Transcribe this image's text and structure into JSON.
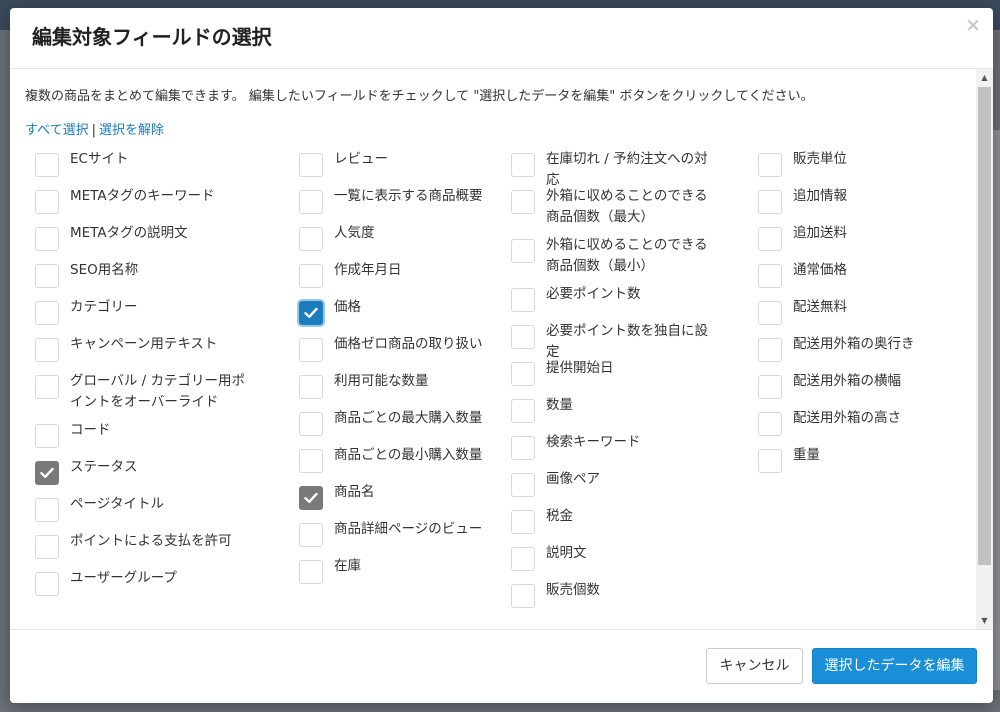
{
  "modal": {
    "title": "編集対象フィールドの選択",
    "close": "×",
    "description": "複数の商品をまとめて編集できます。 編集したいフィールドをチェックして \"選択したデータを編集\" ボタンをクリックしてください。",
    "select_all": "すべて選択",
    "separator": "|",
    "deselect": "選択を解除",
    "cancel_label": "キャンセル",
    "submit_label": "選択したデータを編集"
  },
  "fields": {
    "col1": [
      {
        "label": "ECサイト",
        "checked": false
      },
      {
        "label": "METAタグのキーワード",
        "checked": false
      },
      {
        "label": "METAタグの説明文",
        "checked": false
      },
      {
        "label": "SEO用名称",
        "checked": false
      },
      {
        "label": "カテゴリー",
        "checked": false
      },
      {
        "label": "キャンペーン用テキスト",
        "checked": false
      },
      {
        "label": "グローバル / カテゴリー用ポイントをオーバーライド",
        "checked": false
      },
      {
        "label": "コード",
        "checked": false
      },
      {
        "label": "ステータス",
        "checked": true
      },
      {
        "label": "ページタイトル",
        "checked": false
      },
      {
        "label": "ポイントによる支払を許可",
        "checked": false
      },
      {
        "label": "ユーザーグループ",
        "checked": false
      }
    ],
    "col2": [
      {
        "label": "レビュー",
        "checked": false
      },
      {
        "label": "一覧に表示する商品概要",
        "checked": false
      },
      {
        "label": "人気度",
        "checked": false
      },
      {
        "label": "作成年月日",
        "checked": false
      },
      {
        "label": "価格",
        "checked": true
      },
      {
        "label": "価格ゼロ商品の取り扱い",
        "checked": false
      },
      {
        "label": "利用可能な数量",
        "checked": false
      },
      {
        "label": "商品ごとの最大購入数量",
        "checked": false
      },
      {
        "label": "商品ごとの最小購入数量",
        "checked": false
      },
      {
        "label": "商品名",
        "checked": true
      },
      {
        "label": "商品詳細ページのビュー",
        "checked": false
      },
      {
        "label": "在庫",
        "checked": false
      }
    ],
    "col3": [
      {
        "label": "在庫切れ / 予約注文への対応",
        "checked": false
      },
      {
        "label": "外箱に収めることのできる商品個数（最大）",
        "checked": false
      },
      {
        "label": "外箱に収めることのできる商品個数（最小）",
        "checked": false
      },
      {
        "label": "必要ポイント数",
        "checked": false
      },
      {
        "label": "必要ポイント数を独自に設定",
        "checked": false
      },
      {
        "label": "提供開始日",
        "checked": false
      },
      {
        "label": "数量",
        "checked": false
      },
      {
        "label": "検索キーワード",
        "checked": false
      },
      {
        "label": "画像ペア",
        "checked": false
      },
      {
        "label": "税金",
        "checked": false
      },
      {
        "label": "説明文",
        "checked": false
      },
      {
        "label": "販売個数",
        "checked": false
      }
    ],
    "col4": [
      {
        "label": "販売単位",
        "checked": false
      },
      {
        "label": "追加情報",
        "checked": false
      },
      {
        "label": "追加送料",
        "checked": false
      },
      {
        "label": "通常価格",
        "checked": false
      },
      {
        "label": "配送無料",
        "checked": false
      },
      {
        "label": "配送用外箱の奥行き",
        "checked": false
      },
      {
        "label": "配送用外箱の横幅",
        "checked": false
      },
      {
        "label": "配送用外箱の高さ",
        "checked": false
      },
      {
        "label": "重量",
        "checked": false
      }
    ]
  },
  "colors": {
    "primary": "#1a8fd8",
    "link": "#1a7dbd",
    "checked_gray": "#7a7a7a",
    "focus_checked": "#1a7dbd"
  }
}
